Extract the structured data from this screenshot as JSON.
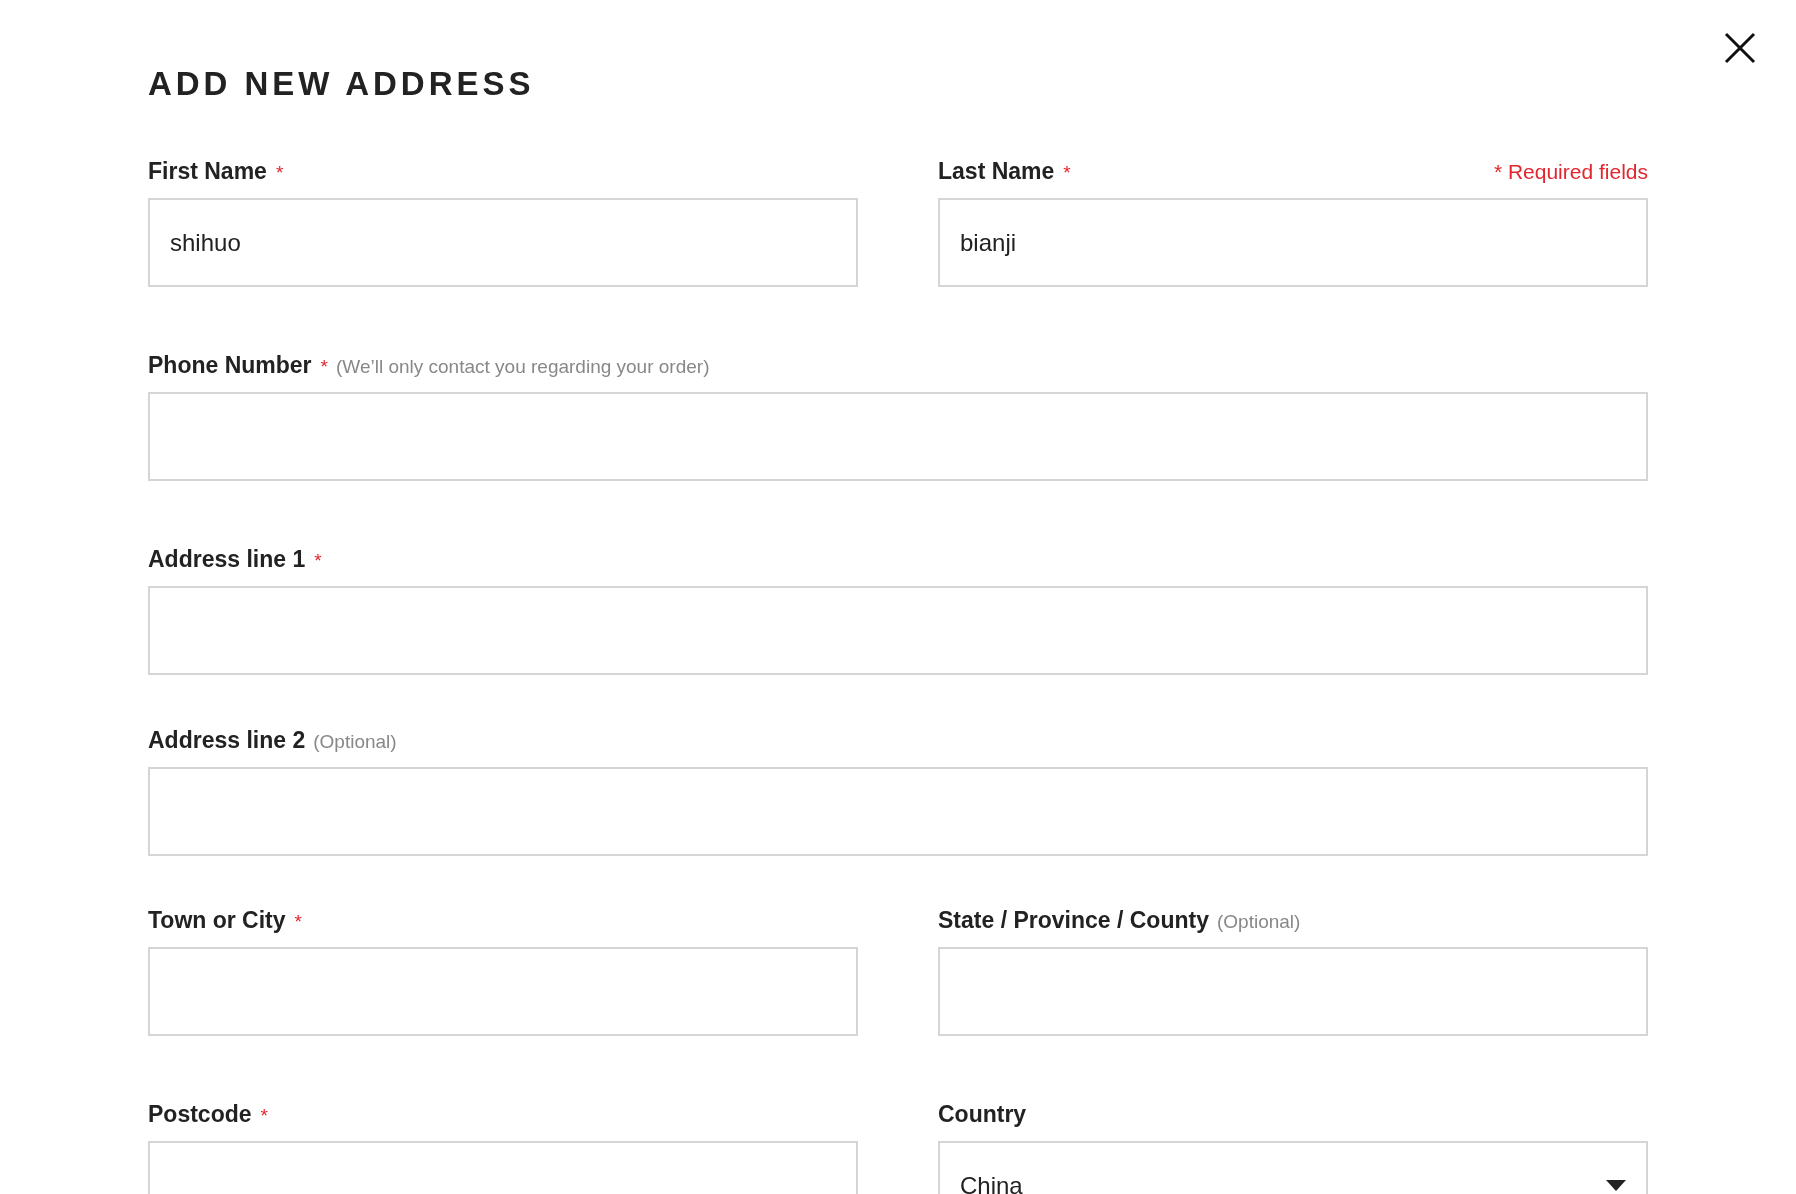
{
  "dialog": {
    "title": "ADD NEW ADDRESS",
    "required_note": "* Required fields"
  },
  "rows": [
    {
      "fields": [
        {
          "kind": "text",
          "label": "First Name",
          "required_mark": "*",
          "value": "shihuo"
        },
        {
          "kind": "text",
          "label": "Last Name",
          "required_mark": "*",
          "value": "bianji"
        }
      ]
    },
    {
      "fields": [
        {
          "kind": "text",
          "label": "Phone Number",
          "required_mark": "*",
          "note": "(We’ll only contact you regarding your order)"
        }
      ]
    },
    {
      "fields": [
        {
          "kind": "text",
          "label": "Address line 1",
          "required_mark": "*"
        }
      ]
    },
    {
      "fields": [
        {
          "kind": "text",
          "label": "Address line 2",
          "note": "(Optional)"
        }
      ]
    },
    {
      "fields": [
        {
          "kind": "text",
          "label": "Town or City",
          "required_mark": "*"
        },
        {
          "kind": "text",
          "label": "State / Province / County",
          "note": "(Optional)"
        }
      ]
    },
    {
      "fields": [
        {
          "kind": "text",
          "label": "Postcode",
          "required_mark": "*"
        },
        {
          "kind": "select",
          "label": "Country",
          "value": "China"
        }
      ]
    }
  ]
}
